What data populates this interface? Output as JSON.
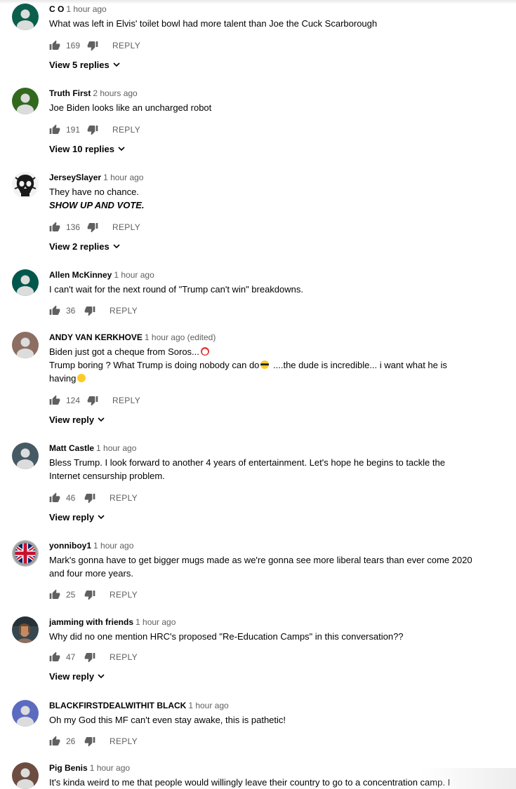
{
  "comments": [
    {
      "author": "C O",
      "time": "1 hour ago",
      "lines": [
        "What was left in Elvis' toilet bowl had more talent than Joe the Cuck Scarborough"
      ],
      "likes": "169",
      "reply_label": "REPLY",
      "replies_label": "View 5 replies",
      "avatar_color": "#0b5e4b"
    },
    {
      "author": "Truth First",
      "time": "2 hours ago",
      "lines": [
        "Joe Biden looks like an uncharged robot"
      ],
      "likes": "191",
      "reply_label": "REPLY",
      "replies_label": "View 10 replies",
      "avatar_color": "#33691e"
    },
    {
      "author": "JerseySlayer",
      "time": "1 hour ago",
      "lines": [
        "They have no chance."
      ],
      "emphasis": "SHOW UP AND VOTE.",
      "likes": "136",
      "reply_label": "REPLY",
      "replies_label": "View 2 replies",
      "avatar_color": "#1a1a1a"
    },
    {
      "author": "Allen McKinney",
      "time": "1 hour ago",
      "lines": [
        "I can't wait for the next round of \"Trump can't win\" breakdowns."
      ],
      "likes": "36",
      "reply_label": "REPLY",
      "avatar_color": "#00574b"
    },
    {
      "author": "ANDY VAN KERKHOVE",
      "time": "1 hour ago (edited)",
      "lines": [
        "Biden just got a cheque from Soros...",
        "Trump boring ? What Trump is doing nobody can do",
        " ....the dude is incredible... i want what he is",
        "having"
      ],
      "likes": "124",
      "reply_label": "REPLY",
      "replies_label": "View reply",
      "avatar_color": "#8d6e63"
    },
    {
      "author": "Matt Castle",
      "time": "1 hour ago",
      "lines": [
        "Bless Trump. I look forward to another 4 years of entertainment. Let's hope he begins to tackle the",
        "Internet censurship problem."
      ],
      "likes": "46",
      "reply_label": "REPLY",
      "replies_label": "View reply",
      "avatar_color": "#455a64"
    },
    {
      "author": "yonniboy1",
      "time": "1 hour ago",
      "lines": [
        "Mark's gonna have to get bigger mugs made as we're gonna see more liberal tears than ever come 2020",
        "and four more years."
      ],
      "likes": "25",
      "reply_label": "REPLY",
      "avatar_color": "#9e9e9e"
    },
    {
      "author": "jamming with friends",
      "time": "1 hour ago",
      "lines": [
        "Why did no one mention HRC's proposed \"Re-Education Camps\" in this conversation??"
      ],
      "likes": "47",
      "reply_label": "REPLY",
      "replies_label": "View reply",
      "avatar_color": "#5d4037"
    },
    {
      "author": "BLACKFIRSTDEALWITHIT BLACK",
      "time": "1 hour ago",
      "lines": [
        "Oh my God this MF can't even stay awake, this is pathetic!"
      ],
      "likes": "26",
      "reply_label": "REPLY",
      "avatar_color": "#5c6bc0"
    },
    {
      "author": "Pig Benis",
      "time": "1 hour ago",
      "lines": [
        "It's kinda weird to me that people would willingly leave their country to go to a concentration camp. I"
      ],
      "avatar_color": "#6d4c41"
    }
  ],
  "icons": {
    "like": "thumbs-up-icon",
    "dislike": "thumbs-down-icon",
    "chevron": "chevron-down-icon",
    "emoji_clown": "clown-emoji-icon",
    "emoji_sunglasses": "sunglasses-emoji-icon",
    "emoji_dizzy": "woozy-emoji-icon"
  }
}
